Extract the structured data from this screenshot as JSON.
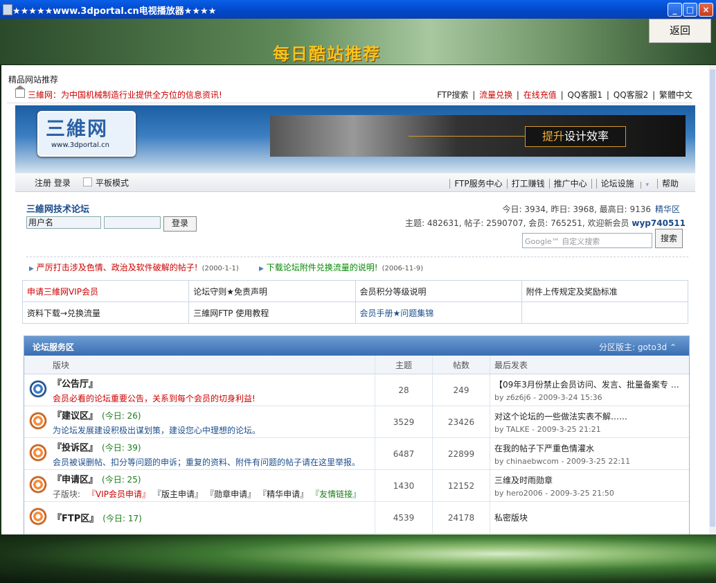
{
  "window": {
    "title": "★★★★★www.3dportal.cn电视播放器★★★★"
  },
  "header": {
    "banner": "每日酷站推荐",
    "back_label": "返回"
  },
  "page": {
    "section_label": "精品网站推荐",
    "top_news": "三維网：为中国机械制造行业提供全方位的信息资讯!",
    "top_links": [
      "FTP搜索",
      "|",
      "流量兑换",
      "|",
      "在线充值",
      "|",
      "QQ客服1",
      "|",
      "QQ客服2",
      "|",
      "繁體中文"
    ]
  },
  "site": {
    "logo_text": "三維网",
    "logo_url": "www.3dportal.cn",
    "ad_highlight": "提升",
    "ad_text": "设计效率"
  },
  "nav": {
    "register_login": "注册  登录",
    "tablet_mode": "平板模式",
    "links": [
      "FTP服务中心",
      "打工赚钱",
      "推广中心",
      "论坛设施",
      "帮助"
    ]
  },
  "forum_info": {
    "name": "三維网技术论坛",
    "username_placeholder": "用户名",
    "login_label": "登录",
    "stats_line1": "今日: 3934, 昨日: 3968, 最高日: 9136",
    "jinghua": "精华区",
    "stats_line2": "主题: 482631, 帖子: 2590707, 会员: 765251, 欢迎新会员",
    "newest_member": "wyp740511",
    "google_hint": "Google™ 自定义搜索",
    "search_label": "搜索"
  },
  "notices": [
    {
      "text": "严厉打击涉及色情、政治及软件破解的帖子!",
      "date": "(2000-1-1)"
    },
    {
      "text": "下载论坛附件兑换流量的说明!",
      "date": "(2006-11-9)"
    }
  ],
  "quick_links": [
    [
      "申请三維网VIP会员",
      "论坛守则★免责声明",
      "会员积分等级说明",
      "附件上传规定及奖励标准"
    ],
    [
      "资料下载→兑换流量",
      "三維网FTP 使用教程",
      "会员手册★问题集锦",
      ""
    ]
  ],
  "forum_section": {
    "title": "论坛服务区",
    "moderator": "分区版主: goto3d",
    "columns": [
      "版块",
      "主题",
      "帖数",
      "最后发表"
    ],
    "rows": [
      {
        "name": "『公告厅』",
        "today": "",
        "desc": "会员必看的论坛重要公告，关系到每个会员的切身利益!",
        "topics": "28",
        "posts": "249",
        "last_title": "【09年3月份禁止会员访问、发言、批量备案专 …",
        "last_by": "by z6z6j6 - 2009-3-24 15:36"
      },
      {
        "name": "『建议区』",
        "today": "(今日: 26)",
        "desc": "为论坛发展建设积极出谋划策，建设您心中理想的论坛。",
        "topics": "3529",
        "posts": "23426",
        "last_title": "对这个论坛的一些做法实表不解……",
        "last_by": "by TALKE - 2009-3-25 21:21"
      },
      {
        "name": "『投诉区』",
        "today": "(今日: 39)",
        "desc": "会员被误删帖、扣分等问题的申诉；重复的资料、附件有问题的帖子请在这里举报。",
        "topics": "6487",
        "posts": "22899",
        "last_title": "在我的帖子下严重色情灌水",
        "last_by": "by chinaebwcom - 2009-3-25 22:11"
      },
      {
        "name": "『申请区』",
        "today": "(今日: 25)",
        "desc": "",
        "topics": "1430",
        "posts": "12152",
        "last_title": "三维及时雨勋章",
        "last_by": "by hero2006 - 2009-3-25 21:50"
      },
      {
        "name": "『FTP区』",
        "today": "(今日: 17)",
        "desc": "",
        "topics": "4539",
        "posts": "24178",
        "last_title": "私密版块",
        "last_by": ""
      }
    ],
    "subforums_label": "子版块:",
    "subforums": [
      "『VIP会员申请』",
      "『版主申请』",
      "『勋章申请』",
      "『精华申请』",
      "『友情链接』"
    ]
  }
}
